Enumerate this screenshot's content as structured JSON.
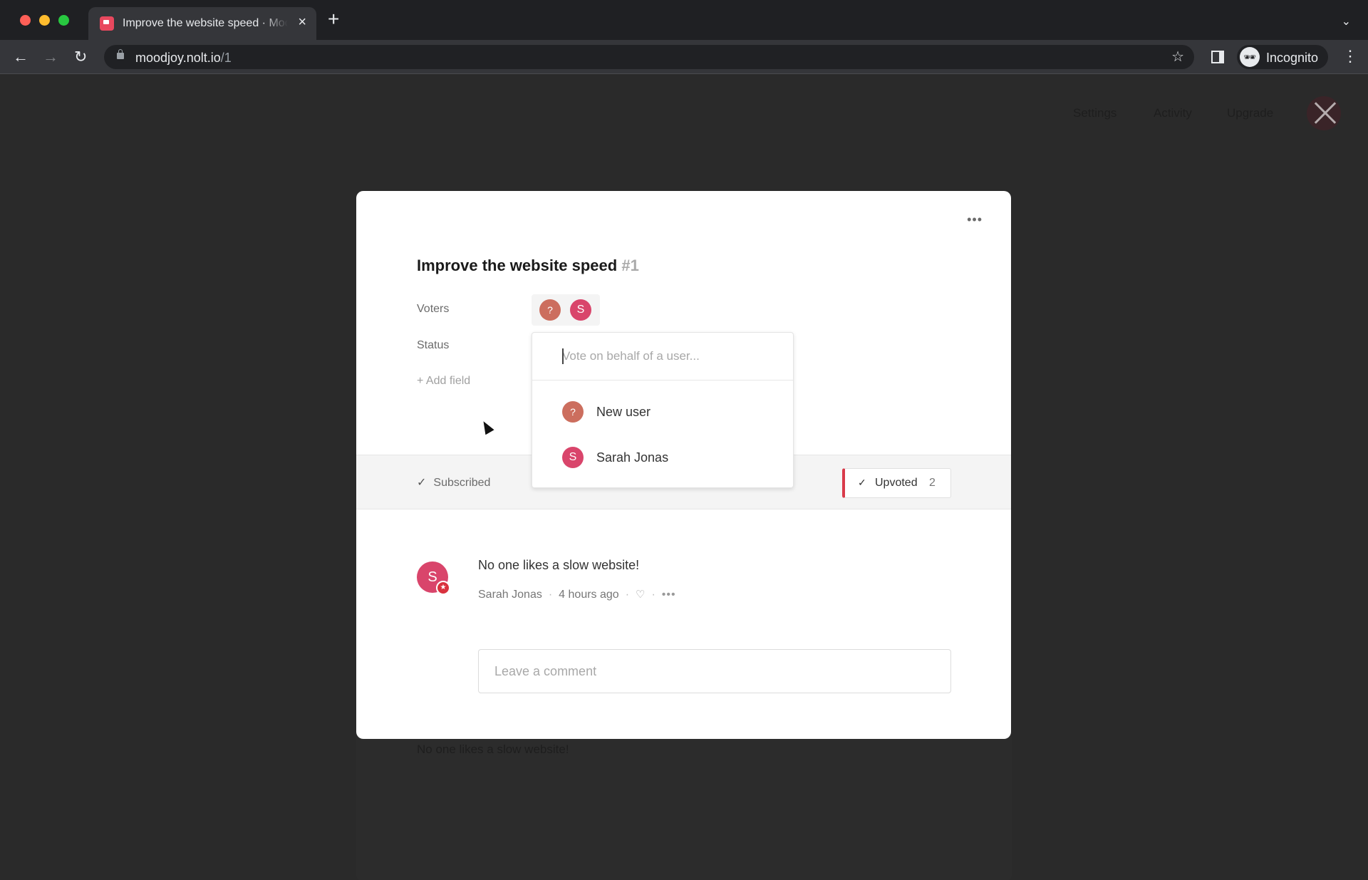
{
  "browser": {
    "tab_title": "Improve the website speed · Moodjoy",
    "tab_close": "×",
    "new_tab": "+",
    "tab_search_icon": "⌄",
    "back_icon": "←",
    "forward_icon": "→",
    "reload_icon": "↻",
    "url_host": "moodjoy.nolt.io",
    "url_path": "/1",
    "bookmark_icon": "☆",
    "profile_label": "Incognito",
    "incognito_icon": "🕶",
    "menu_icon": "⋮"
  },
  "background_page": {
    "nav": [
      "Settings",
      "Activity",
      "Upgrade"
    ],
    "comment_preview": "No one likes a slow website!"
  },
  "modal": {
    "more_icon": "•••",
    "title": "Improve the website speed",
    "number": "#1",
    "fields": {
      "voters_label": "Voters",
      "status_label": "Status",
      "add_field": "+ Add field"
    },
    "voters": [
      {
        "initial": "?",
        "name": "New user",
        "color": "#cc6e5e"
      },
      {
        "initial": "S",
        "name": "Sarah Jonas",
        "color": "#d9456b"
      }
    ],
    "vote_dropdown": {
      "placeholder": "Vote on behalf of a user...",
      "value": "",
      "options": [
        {
          "initial": "?",
          "name": "New user"
        },
        {
          "initial": "S",
          "name": "Sarah Jonas"
        }
      ]
    },
    "subscription": {
      "check": "✓",
      "label": "Subscribed"
    },
    "upvote": {
      "check": "✓",
      "label": "Upvoted",
      "count": "2",
      "accent": "#d93a4a"
    },
    "comments": [
      {
        "initial": "S",
        "author": "Sarah Jonas",
        "badge": "★",
        "text": "No one likes a slow website!",
        "time": "4 hours ago",
        "like_icon": "♡",
        "more_icon": "•••"
      }
    ],
    "comment_input": {
      "placeholder": "Leave a comment",
      "value": ""
    }
  }
}
